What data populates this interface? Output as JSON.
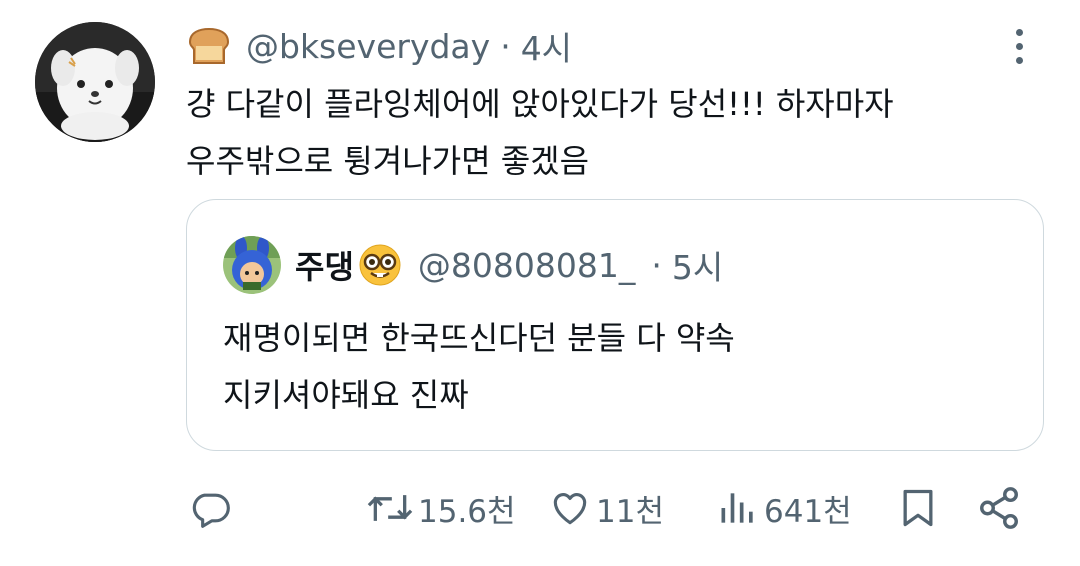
{
  "tweet": {
    "avatar_icon": "white-puppy-avatar",
    "badge_icon": "bread-emoji",
    "handle": "@bkseveryday",
    "separator": "·",
    "time": "4시",
    "text_lines": [
      "걍 다같이 플라잉체어에 앉아있다가 당선!!! 하자마자",
      "우주밖으로 튕겨나가면 좋겠음"
    ]
  },
  "quote": {
    "avatar_icon": "blue-bunny-hood-avatar",
    "name": "주댕",
    "name_emoji": "nerd-face-emoji",
    "handle": "@80808081_",
    "separator": "·",
    "time": "5시",
    "text_lines": [
      "재명이되면 한국뜨신다던 분들 다 약속",
      "지키셔야돼요 진짜"
    ]
  },
  "actions": {
    "reply_icon": "reply-icon",
    "retweet_icon": "retweet-icon",
    "retweet_count": "15.6천",
    "like_icon": "heart-icon",
    "like_count": "11천",
    "views_icon": "views-icon",
    "views_count": "641천",
    "bookmark_icon": "bookmark-icon",
    "share_icon": "share-icon"
  },
  "colors": {
    "text_primary": "#0f1419",
    "text_secondary": "#536471",
    "border": "#cfd9de",
    "background": "#ffffff"
  }
}
